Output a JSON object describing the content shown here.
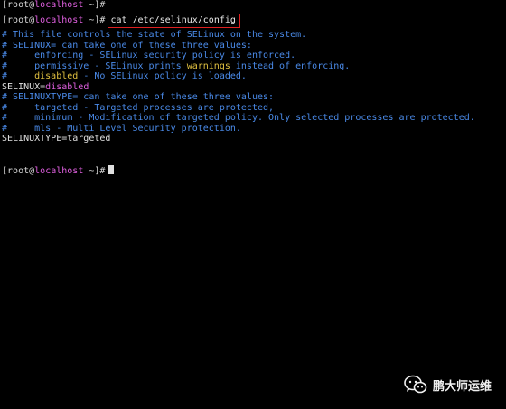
{
  "terminal": {
    "prompt1": {
      "open": "[",
      "user": "root",
      "at": "@",
      "host": "localhost",
      "path": " ~]#"
    },
    "prompt2": {
      "open": "[",
      "user": "root",
      "at": "@",
      "host": "localhost",
      "path": " ~]#",
      "command": "cat /etc/selinux/config"
    },
    "lines": {
      "l1": "# This file controls the state of SELinux on the system.",
      "l2": "# SELINUX= can take one of these three values:",
      "l3": "#     enforcing - SELinux security policy is enforced.",
      "l4a": "#     permissive - SELinux prints ",
      "l4b": "warnings",
      "l4c": " instead of enforcing.",
      "l5a": "#     ",
      "l5b": "disabled",
      "l5c": " - No SELinux policy is loaded.",
      "l6a": "SELINUX=",
      "l6b": "disabled",
      "l7": "# SELINUXTYPE= can take one of these three values:",
      "l8": "#     targeted - Targeted processes are protected,",
      "l9": "#     minimum - Modification of targeted policy. Only selected processes are protected.",
      "l10": "#     mls - Multi Level Security protection.",
      "l11": "SELINUXTYPE=targeted"
    },
    "prompt3": {
      "open": "[",
      "user": "root",
      "at": "@",
      "host": "localhost",
      "path": " ~]#"
    }
  },
  "watermark": {
    "icon": "wechat-icon",
    "text": "鹏大师运维"
  },
  "colors": {
    "background": "#000000",
    "comment": "#4a8ae8",
    "host": "#e060e0",
    "warning": "#e0c040",
    "highlight_box": "#e02020"
  }
}
